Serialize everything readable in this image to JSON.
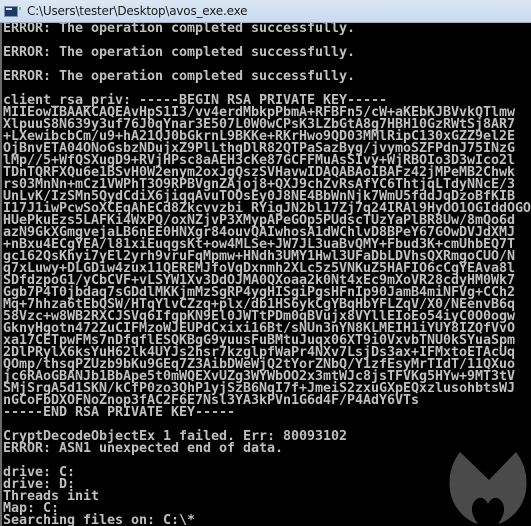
{
  "window": {
    "title": "C:\\Users\\tester\\Desktop\\avos_exe.exe",
    "icon": "console-app-icon"
  },
  "console": {
    "lines": [
      "ERROR: The operation completed successfully.",
      "",
      "ERROR: The operation completed successfully.",
      "",
      "ERROR: The operation completed successfully.",
      "",
      "client_rsa_priv: -----BEGIN RSA PRIVATE KEY-----",
      "MIIEowIBAAKCAQEAvHpS1I3/vv4erdMbkpPbmA+RFBFn5/cW+aKEbKJBVvkQTlmw",
      "XlpuuS8N639y3uf76J0qYnar3E507L0W0wCPsK3LZbGtA8g7HBH10GzRWtSj8AR7",
      "+LXewibcbCm/u9+hA21QJ0bGkrnL9BKKe+RKrHwo9QD03MMlRipC130xGZZ9el2E",
      "OjBnvETA04ONoGsbzNDujxZ9PlLthqDlR82QTPaSazByg/jvymoSZFPdnJ75INzG",
      "lMp//5+WfQSXugD9+RVjHPsc8aAEH3cKe87GCFFMuAsSIvy+WjRBOIo3D3wIco2l",
      "TDnTQRFXQu6e1BSvH0W2enym2oxJgQszSVHavwIDAQABAoIBAFz42jMPeMB2Chwk",
      "rs03MnNn+mCz1VWPhT3O9RPBVgnZAjoj8+QXJ9chZvRsAfYC6ThtjqLTdyNNcE/3",
      "UnLvK/IzSMn5QydCdiX6jiqqAvuTOOsEy0J8NE4BbWnNjk7WmU5fddJqDzoBfKIB",
      "I17J1iwPcwSoXCEqAhECd8Zkcvvzbi RYigJN2bl17Zj7q24IRAl9HyOO1OGIddOGO",
      "HUePkuEzs5LAFKi4WxPQ/oxNZjvP3XMypAPeGOp5PUdscTUzYaPlBR8Uw/8mQo6d",
      "azN9GkXGmgvejaLB6nEE0HNXgr84ouvQAIwhosA1dWChlvD8BPeY67GOwDVJdXMJ",
      "+nBxu4ECgYEA/l81xiEuqgsKt+ow4MLSe+JW7JL3uaBvQMY+Fbud3K+cmUhbEQ7T",
      "gc162QsKhyi7yEl2yrh9vruFqMpmw+HNdh3UMY1Hwl3UFaDbLDVhsQXRmgoCUO/N",
      "q7xLuwy+DLGDiw4zux11QEREMJfoVqDxnmh2XLc5z5VNKuZ5HAFIO6cCgYEAva8l",
      "SDfdzpoG1/yCbCVF+vLSYW1Xv3DdOJMA0QXoaa2k0Nt4xEc9mXoVR28cdyHM0Wk7",
      "Ggb7P4T0jbdaq7sGDdlMKKjmMzSgRP4ygHISgiPgsHFnIp90JamB4miNFVg+CCh2",
      "Mq+7hhza6tEbQSW/HTqYlvCZzq+plx/db1HS6ykCgYBqHbYFLZqV/X0/NEenvB6q",
      "58Vzc+w8WB2RXCJSVq6IfgpKN9El0JWTtPDm0qBVujx8VYllEIoEo54iyC0O0ogw",
      "GknyHgotn472ZuCIFMzoWJEUPdCxixi16Bt/sNUn3nYN8KLMEIH1iYUY8IZQfVvO",
      "xa17CETpwFMs7nDfqflESQKBgG9yuusFuBMtuJuqx06XT9i0VxvbTNU0kSYuaSpm",
      "2DlPRylX6ksYuH62lk4UYJs2hsr7kzglpfWaPr4NXv7LsjDs3ax+IFMxtoETAcUq",
      "QOmp/thsqPZUzb9bKu9GEq7Z3AibDWeWjQ2tYorZNbQ/Y1zfEsyMrTIdT/11QXuo",
      "jc6RAoGBANJb1BbApe5t0mWQEXvUZg3WYWbOO2x3mtWJc8jsTFVKg5HYw+9MT3tV",
      "SMjSrgA5d1SKN/kCfP0zo3QhP1yjSzB6NqI7f+JmeiS2zxuGXpEQxzlusohbtsWJ",
      "nGCoFbDXOFNoZnop3fAC2F6E7Nsl3YA3kPVn1G6d4F/P4AdY6VTs",
      "-----END RSA PRIVATE KEY-----",
      "",
      "CryptDecodeObjectEx 1 failed. Err: 80093102",
      "ERROR: ASN1 unexpected end of data.",
      "",
      "drive: C:",
      "drive: D:",
      "Threads init",
      "Map: C:",
      "Searching files on: C:\\*"
    ]
  },
  "overlay": {
    "watermark": "malwarebytes-logo",
    "watermark_color": "#4a4a4a"
  },
  "colors": {
    "console_bg": "#000000",
    "console_text": "#c0c0c0",
    "titlebar": "#d4e2f1"
  }
}
